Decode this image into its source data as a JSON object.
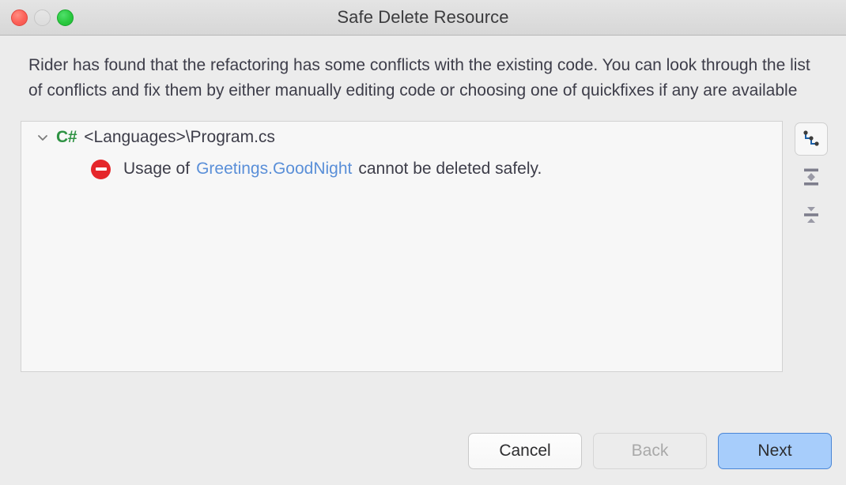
{
  "window": {
    "title": "Safe Delete Resource",
    "traffic_lights": [
      {
        "name": "close",
        "color": "#fc6058"
      },
      {
        "name": "minimize",
        "color": "#e0e0e0"
      },
      {
        "name": "maximize",
        "color": "#2bc940"
      }
    ]
  },
  "description": "Rider has found that the refactoring has some conflicts with the existing code. You can look through the list of conflicts and fix them by either manually editing code or choosing one of quickfixes if any are available",
  "tree": {
    "file_node": {
      "expander": "chevron-down",
      "language_badge": "C#",
      "path": "<Languages>\\Program.cs"
    },
    "conflict": {
      "icon": "error-no-entry",
      "prefix": "Usage of",
      "symbol": "Greetings.GoodNight",
      "suffix": "cannot be deleted safely."
    }
  },
  "side_toolbar": {
    "items": [
      {
        "name": "group-by-structure",
        "label": "Group by structure",
        "active": true
      },
      {
        "name": "expand-all",
        "label": "Expand All",
        "active": false
      },
      {
        "name": "collapse-all",
        "label": "Collapse All",
        "active": false
      }
    ]
  },
  "footer": {
    "cancel_label": "Cancel",
    "back_label": "Back",
    "next_label": "Next"
  },
  "colors": {
    "accent_blue": "#a7cdfb",
    "accent_border": "#4a86d6",
    "link_blue": "#5a8fd8",
    "badge_green": "#2e9243",
    "error_red": "#e5262a",
    "text": "#3d3d49"
  }
}
